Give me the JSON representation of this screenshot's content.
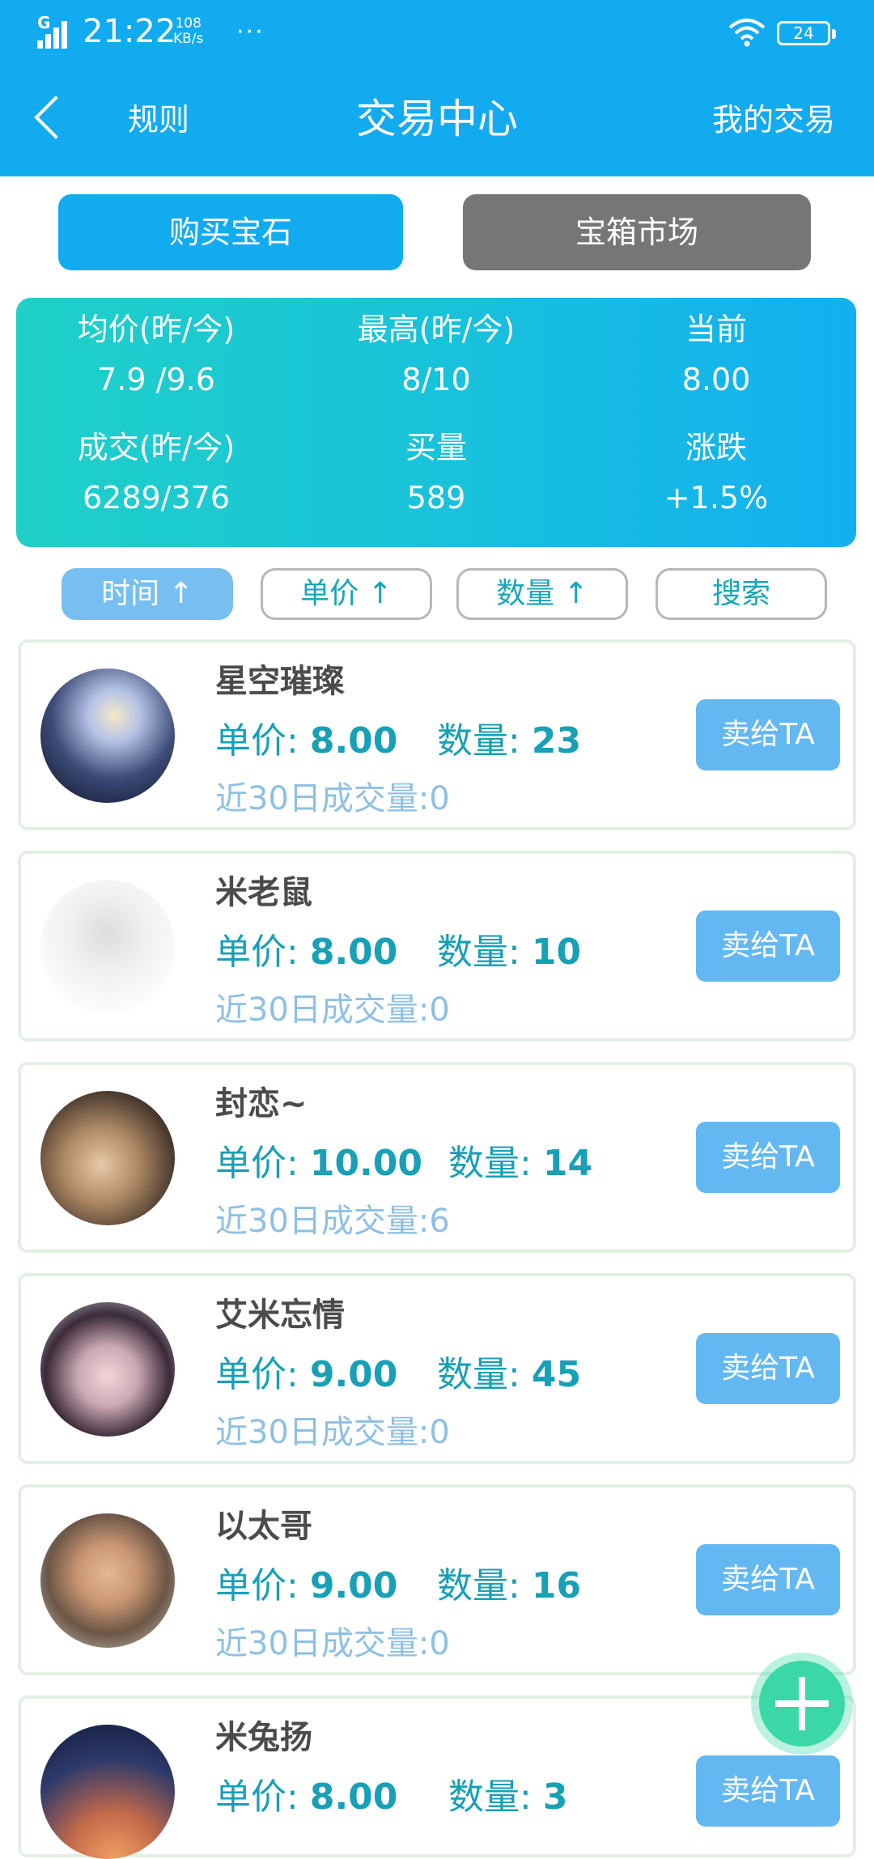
{
  "status_bar": {
    "signal_label": "G",
    "time": "21:22",
    "net_speed_value": "108",
    "net_speed_unit": "KB/s",
    "more": "···",
    "battery": "24"
  },
  "nav": {
    "rules": "规则",
    "title": "交易中心",
    "my_trades": "我的交易"
  },
  "tabs": {
    "buy_gems": "购买宝石",
    "chest_market": "宝箱市场"
  },
  "stats": [
    {
      "label": "均价(昨/今)",
      "value": "7.9 /9.6"
    },
    {
      "label": "最高(昨/今)",
      "value": "8/10"
    },
    {
      "label": "当前",
      "value": "8.00"
    },
    {
      "label": "成交(昨/今)",
      "value": "6289/376"
    },
    {
      "label": "买量",
      "value": "589"
    },
    {
      "label": "涨跌",
      "value": "+1.5%"
    }
  ],
  "sort": [
    {
      "label": "时间 ↑"
    },
    {
      "label": "单价 ↑"
    },
    {
      "label": "数量 ↑"
    },
    {
      "label": "搜索"
    }
  ],
  "listings": [
    {
      "name": "星空璀璨",
      "price_label": "单价:",
      "price": "8.00",
      "qty_label": "数量:",
      "qty": "23",
      "vol_label": "近30日成交量:",
      "vol": "0",
      "button": "卖给TA"
    },
    {
      "name": "米老鼠",
      "price_label": "单价:",
      "price": "8.00",
      "qty_label": "数量:",
      "qty": "10",
      "vol_label": "近30日成交量:",
      "vol": "0",
      "button": "卖给TA"
    },
    {
      "name": "封恋~",
      "price_label": "单价:",
      "price": "10.00",
      "qty_label": "数量:",
      "qty": "14",
      "vol_label": "近30日成交量:",
      "vol": "6",
      "button": "卖给TA"
    },
    {
      "name": "艾米忘情",
      "price_label": "单价:",
      "price": "9.00",
      "qty_label": "数量:",
      "qty": "45",
      "vol_label": "近30日成交量:",
      "vol": "0",
      "button": "卖给TA"
    },
    {
      "name": "以太哥",
      "price_label": "单价:",
      "price": "9.00",
      "qty_label": "数量:",
      "qty": "16",
      "vol_label": "近30日成交量:",
      "vol": "0",
      "button": "卖给TA"
    },
    {
      "name": "米兔扬",
      "price_label": "单价:",
      "price": "8.00",
      "qty_label": "数量:",
      "qty": "3",
      "vol_label": "",
      "vol": "",
      "button": "卖给TA"
    }
  ],
  "icons": {
    "back": "chevron-left-icon",
    "fab": "plus-icon"
  },
  "colors": {
    "header_bg": "#12abf0",
    "buy_tab_bg": "#12abf0",
    "chest_tab_bg": "#767676",
    "sell_button_bg": "#64b8f2",
    "accent_text": "#17a0b6",
    "fab_bg": "#3ad7a7"
  }
}
